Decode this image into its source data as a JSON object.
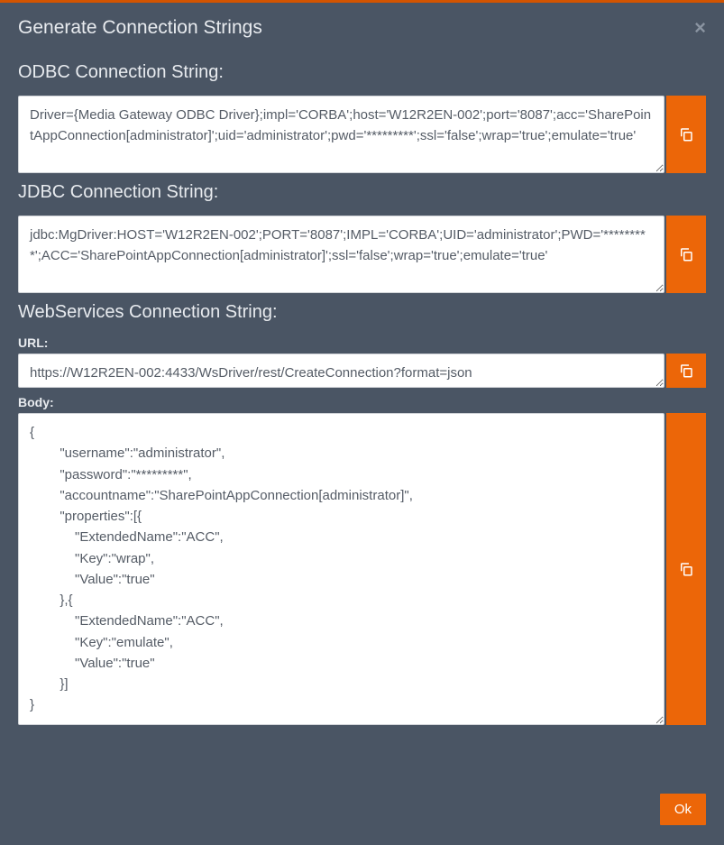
{
  "modal": {
    "title": "Generate Connection Strings",
    "close_label": "×",
    "ok_label": "Ok"
  },
  "odbc": {
    "label": "ODBC Connection String:",
    "value": "Driver={Media Gateway ODBC Driver};impl='CORBA';host='W12R2EN-002';port='8087';acc='SharePointAppConnection[administrator]';uid='administrator';pwd='*********';ssl='false';wrap='true';emulate='true'"
  },
  "jdbc": {
    "label": "JDBC Connection String:",
    "value": "jdbc:MgDriver:HOST='W12R2EN-002';PORT='8087';IMPL='CORBA';UID='administrator';PWD='*********';ACC='SharePointAppConnection[administrator]';ssl='false';wrap='true';emulate='true'"
  },
  "ws": {
    "label": "WebServices Connection String:",
    "url_label": "URL:",
    "url_value": "https://W12R2EN-002:4433/WsDriver/rest/CreateConnection?format=json",
    "body_label": "Body:",
    "body_value": "{\n        \"username\":\"administrator\",\n        \"password\":\"*********\",\n        \"accountname\":\"SharePointAppConnection[administrator]\",\n        \"properties\":[{\n            \"ExtendedName\":\"ACC\",\n            \"Key\":\"wrap\",\n            \"Value\":\"true\"\n        },{\n            \"ExtendedName\":\"ACC\",\n            \"Key\":\"emulate\",\n            \"Value\":\"true\"\n        }]\n}"
  }
}
